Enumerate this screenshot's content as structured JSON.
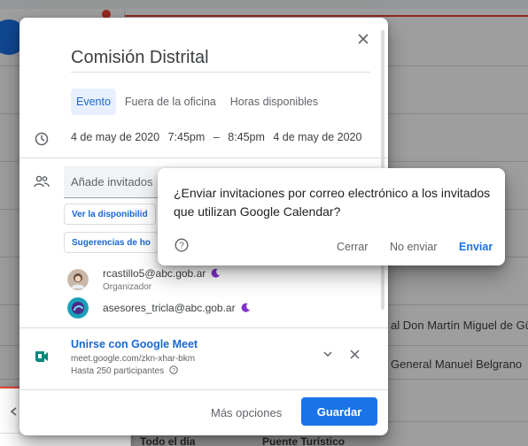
{
  "background": {
    "rows": [
      {
        "label": "al Don Martín Miguel de Güe"
      },
      {
        "label": "General Manuel Belgrano"
      }
    ],
    "bottom_row": {
      "left": "Todo el día",
      "right": "Puente Turístico"
    }
  },
  "editor": {
    "title": "Comisión Distrital",
    "tabs": [
      {
        "label": "Evento"
      },
      {
        "label": "Fuera de la oficina"
      },
      {
        "label": "Horas disponibles"
      }
    ],
    "date_start": "4 de may de 2020",
    "time_start": "7:45pm",
    "time_sep": "–",
    "time_end": "8:45pm",
    "date_end": "4 de may de 2020",
    "guests_placeholder": "Añade invitados",
    "availability_button": "Ver la disponibilid",
    "suggestions_button": "Sugerencias de ho",
    "guests": [
      {
        "email": "rcastillo5@abc.gob.ar",
        "role": "Organizador"
      },
      {
        "email": "asesores_tricla@abc.gob.ar"
      }
    ],
    "meet": {
      "title": "Unirse con Google Meet",
      "link": "meet.google.com/zkn-xhar-bkm",
      "limit": "Hasta 250 participantes"
    },
    "footer": {
      "more_options": "Más opciones",
      "save": "Guardar"
    }
  },
  "dialog": {
    "message": "¿Enviar invitaciones por correo electrónico a los invitados que utilizan Google Calendar?",
    "close": "Cerrar",
    "dont_send": "No enviar",
    "send": "Enviar"
  },
  "icons": {
    "close": "close-icon",
    "clock": "clock-icon",
    "people": "people-icon",
    "meet": "google-meet-icon",
    "help": "help-circle-icon",
    "chevron": "chevron-down-icon",
    "moon": "moon-icon",
    "mail": "mail-icon",
    "more": "more-vert-icon"
  },
  "colors": {
    "accent": "#1a73e8",
    "accent_text": "#1967d2",
    "tab_active_bg": "#e8f0fe",
    "current_time": "#ea4335",
    "meet_green": "#00897b",
    "moon": "#8430ce"
  }
}
